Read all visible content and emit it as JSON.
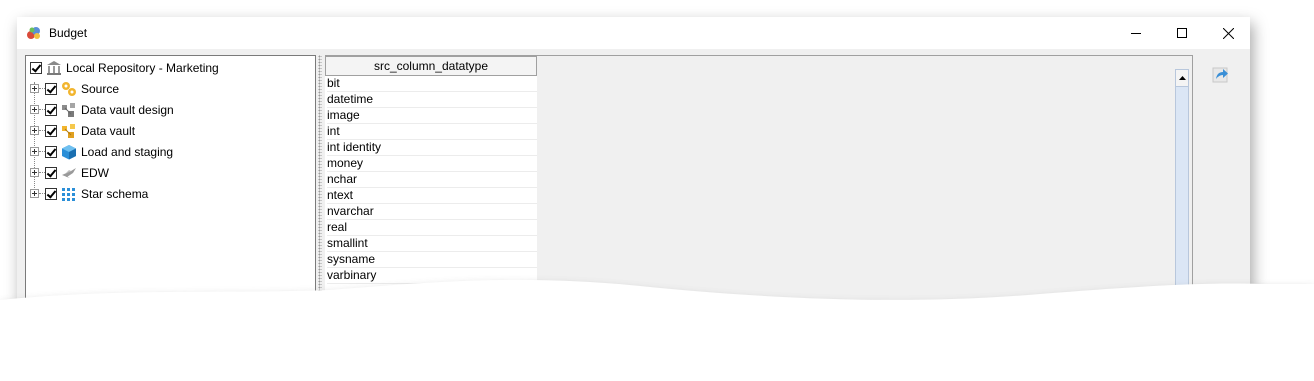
{
  "window": {
    "title": "Budget"
  },
  "tree": {
    "root": {
      "label": "Local Repository - Marketing",
      "icon": "repository-icon"
    },
    "items": [
      {
        "label": "Source",
        "icon": "source-icon"
      },
      {
        "label": "Data vault design",
        "icon": "data-vault-design-icon"
      },
      {
        "label": "Data vault",
        "icon": "data-vault-icon"
      },
      {
        "label": "Load and staging",
        "icon": "load-staging-icon"
      },
      {
        "label": "EDW",
        "icon": "edw-icon"
      },
      {
        "label": "Star schema",
        "icon": "star-schema-icon"
      }
    ]
  },
  "grid": {
    "column_header": "src_column_datatype",
    "rows": [
      "bit",
      "datetime",
      "image",
      "int",
      "int identity",
      "money",
      "nchar",
      "ntext",
      "nvarchar",
      "real",
      "smallint",
      "sysname",
      "varbinary"
    ]
  },
  "side_toolbar": {
    "export_icon": "export-arrow-icon"
  },
  "colors": {
    "window_bg": "#f0f0f0",
    "panel_bg": "#ffffff",
    "scrollbar_track": "#dbe6f5",
    "export_arrow": "#3a8fd6"
  }
}
